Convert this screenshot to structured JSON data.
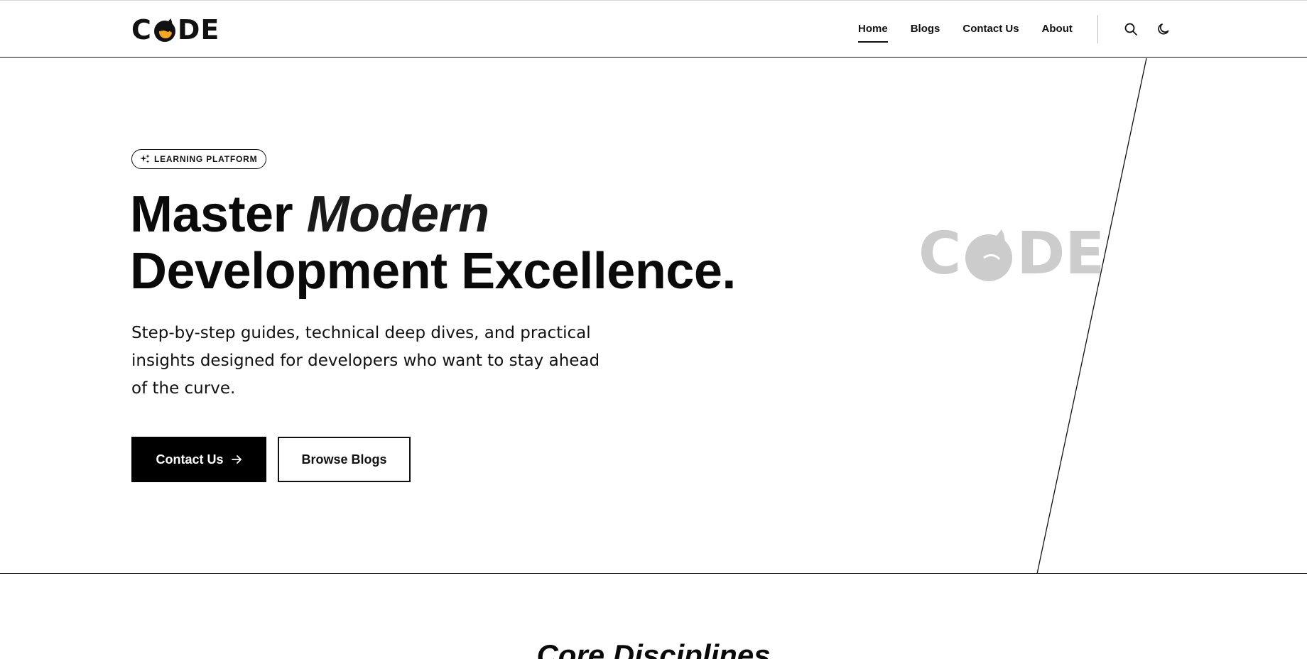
{
  "brand": {
    "logo_left": "C",
    "logo_right": "DE",
    "logo_text": "CODE",
    "accent_color": "#f5a623",
    "ink_color": "#111111",
    "watermark_color": "#cccccc"
  },
  "nav": {
    "items": [
      {
        "label": "Home",
        "active": true
      },
      {
        "label": "Blogs",
        "active": false
      },
      {
        "label": "Contact Us",
        "active": false
      },
      {
        "label": "About",
        "active": false
      }
    ],
    "search_icon": "search-icon",
    "theme_icon": "moon-icon"
  },
  "hero": {
    "badge_icon": "sparkle-icon",
    "badge_label": "LEARNING PLATFORM",
    "headline_part1": "Master ",
    "headline_italic": "Modern",
    "headline_line2": "Development Excellence.",
    "subtext": "Step-by-step guides, technical deep dives, and practical insights designed for developers who want to stay ahead of the curve.",
    "primary_cta": "Contact Us",
    "primary_cta_icon": "arrow-right-icon",
    "secondary_cta": "Browse Blogs"
  },
  "section": {
    "title": "Core Disciplines"
  }
}
